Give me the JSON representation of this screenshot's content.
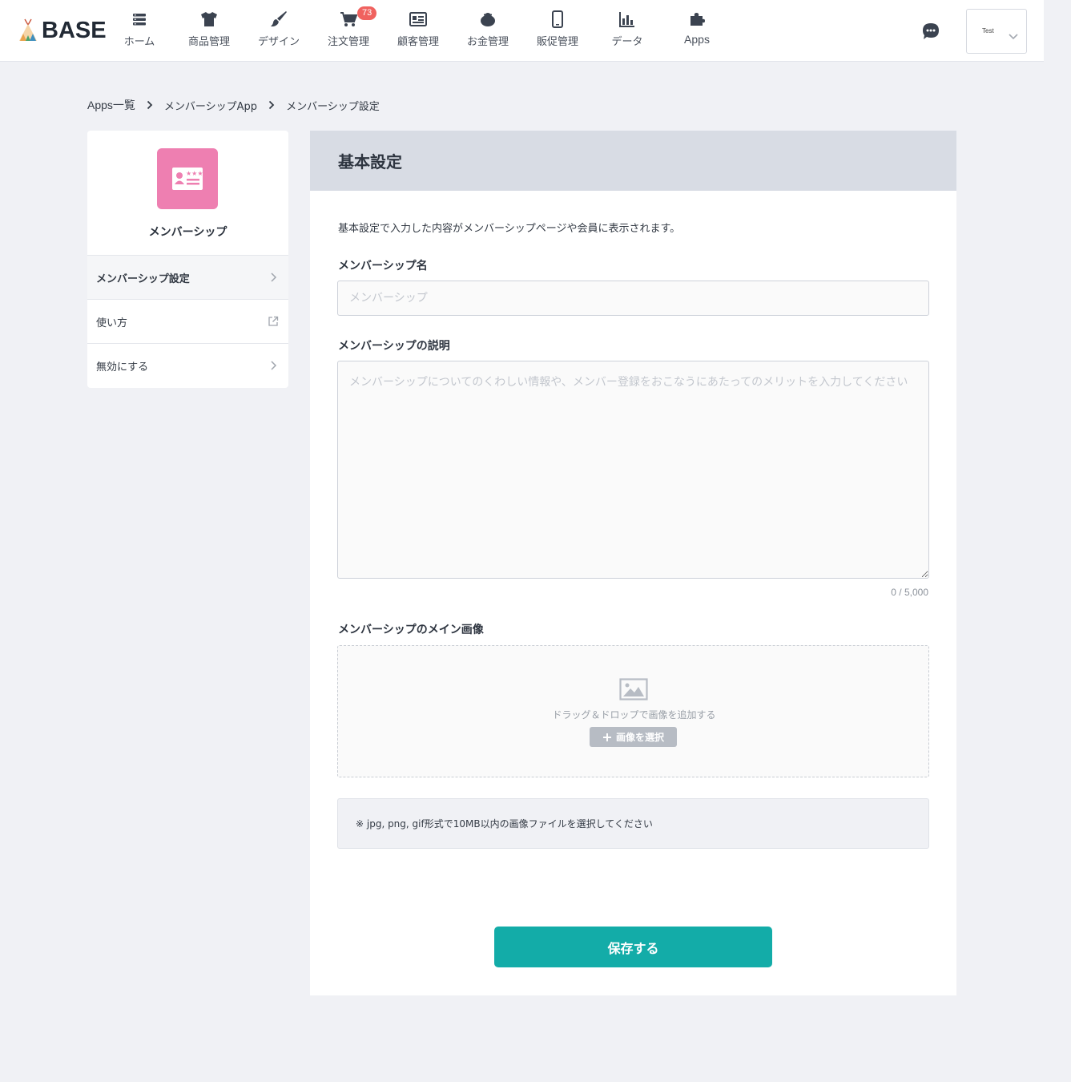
{
  "header": {
    "logo_text": "BASE",
    "nav": [
      {
        "id": "home",
        "label": "ホーム",
        "icon": "list-icon"
      },
      {
        "id": "products",
        "label": "商品管理",
        "icon": "tshirt-icon"
      },
      {
        "id": "design",
        "label": "デザイン",
        "icon": "brush-icon"
      },
      {
        "id": "orders",
        "label": "注文管理",
        "icon": "cart-icon",
        "badge": "73"
      },
      {
        "id": "customers",
        "label": "顧客管理",
        "icon": "id-card-icon"
      },
      {
        "id": "finance",
        "label": "お金管理",
        "icon": "wallet-icon"
      },
      {
        "id": "promotion",
        "label": "販促管理",
        "icon": "phone-icon"
      },
      {
        "id": "data",
        "label": "データ",
        "icon": "bar-chart-icon"
      },
      {
        "id": "apps",
        "label": "Apps",
        "icon": "puzzle-icon"
      }
    ],
    "user_name": "Test"
  },
  "breadcrumb": {
    "items": [
      "Apps一覧",
      "メンバーシップApp",
      "メンバーシップ設定"
    ]
  },
  "sidebar": {
    "app_title": "メンバーシップ",
    "items": [
      {
        "label": "メンバーシップ設定",
        "icon": "chevron-right-icon"
      },
      {
        "label": "使い方",
        "icon": "external-link-icon"
      },
      {
        "label": "無効にする",
        "icon": "chevron-right-icon"
      }
    ]
  },
  "main": {
    "section_title": "基本設定",
    "description": "基本設定で入力した内容がメンバーシップページや会員に表示されます。",
    "name_label": "メンバーシップ名",
    "name_placeholder": "メンバーシップ",
    "desc_label": "メンバーシップの説明",
    "desc_placeholder": "メンバーシップについてのくわしい情報や、メンバー登録をおこなうにあたってのメリットを入力してください",
    "counter": "0 / 5,000",
    "image_label": "メンバーシップのメイン画像",
    "dropzone_text": "ドラッグ＆ドロップで画像を追加する",
    "select_image_button": "画像を選択",
    "note": "※ jpg, png, gif形式で10MB以内の画像ファイルを選択してください",
    "save_button": "保存する"
  },
  "colors": {
    "accent": "#13aca8",
    "app_icon_bg": "#ee7fb1",
    "badge": "#f0625f",
    "page_bg": "#f0f1f5",
    "section_header_bg": "#d8dce4"
  }
}
